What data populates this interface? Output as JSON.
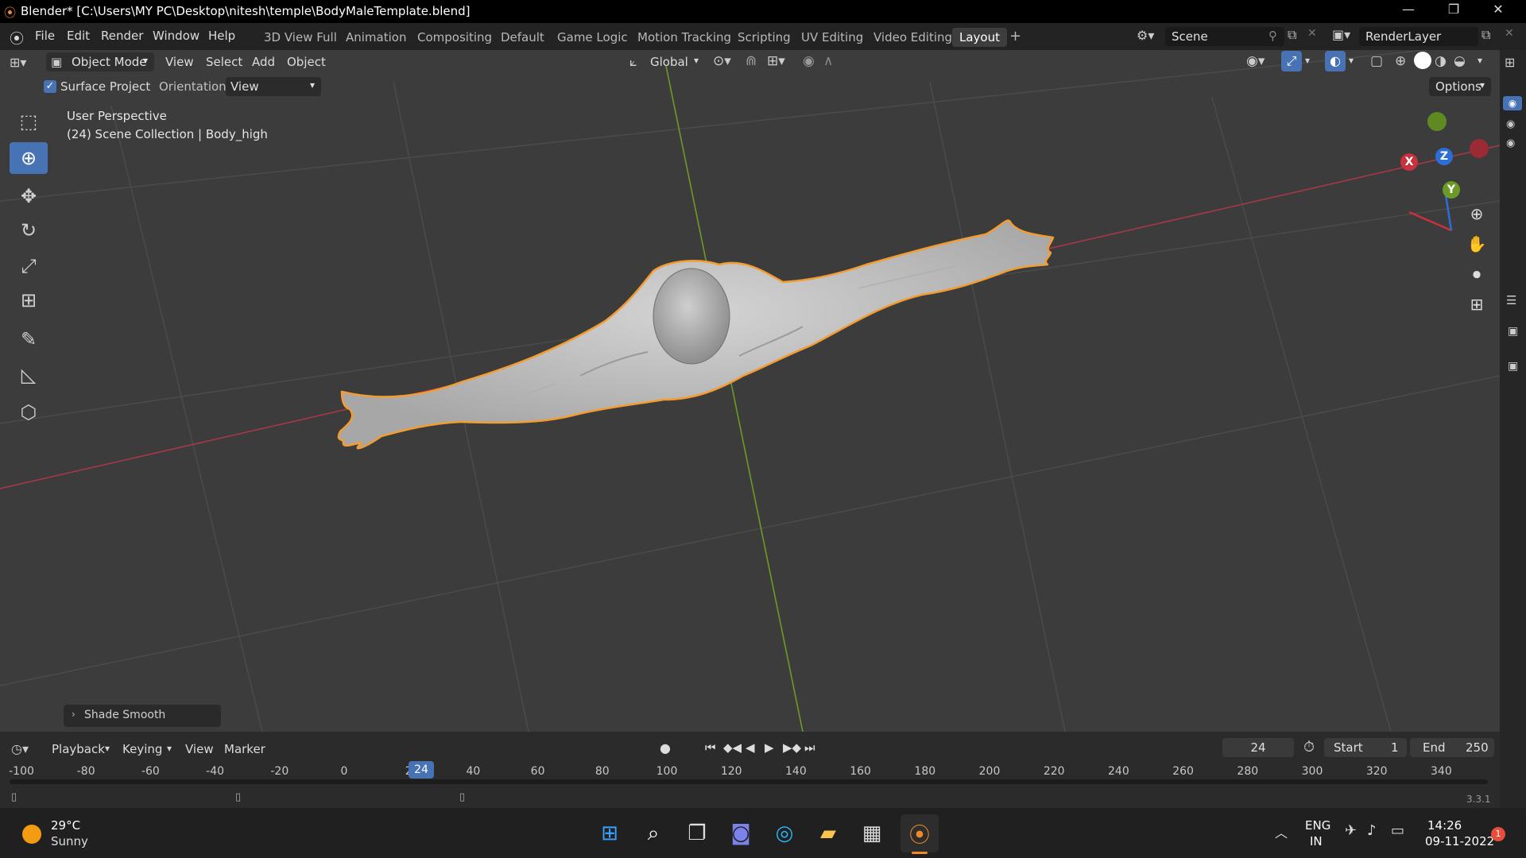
{
  "titlebar": {
    "title": "Blender* [C:\\Users\\MY PC\\Desktop\\nitesh\\temple\\BodyMaleTemplate.blend]",
    "minimize": "—",
    "restore": "❐",
    "close": "✕"
  },
  "menus": [
    "File",
    "Edit",
    "Render",
    "Window",
    "Help"
  ],
  "workspaces": [
    "3D View Full",
    "Animation",
    "Compositing",
    "Default",
    "Game Logic",
    "Motion Tracking",
    "Scripting",
    "UV Editing",
    "Video Editing",
    "Layout"
  ],
  "active_workspace": "Layout",
  "add_workspace": "+",
  "scene": {
    "label": "Scene"
  },
  "render_layer": {
    "label": "RenderLayer"
  },
  "header": {
    "mode": "Object Mode",
    "menus": [
      "View",
      "Select",
      "Add",
      "Object"
    ],
    "transform_orientation": "Global"
  },
  "tool_settings": {
    "surface_project_label": "Surface Project",
    "surface_project_checked": true,
    "orientation_label": "Orientation:",
    "orientation_value": "View",
    "options_label": "Options"
  },
  "viewport": {
    "perspective": "User Perspective",
    "collection_info": "(24) Scene Collection | Body_high",
    "last_operation": "Shade Smooth",
    "gizmo": {
      "x": "X",
      "y": "Y",
      "z": "Z"
    }
  },
  "colors": {
    "selection_outline": "#f39c32",
    "x_axis": "#c8313e",
    "y_axis": "#6a9a1f",
    "z_axis": "#2b6fd6",
    "active_tool": "#4772b3"
  },
  "timeline": {
    "menus": [
      "Playback",
      "Keying",
      "View",
      "Marker"
    ],
    "current_frame": "24",
    "start_label": "Start",
    "start_value": "1",
    "end_label": "End",
    "end_value": "250",
    "ruler_labels": [
      "-100",
      "-80",
      "-60",
      "-40",
      "-20",
      "0",
      "2",
      "40",
      "60",
      "80",
      "100",
      "120",
      "140",
      "160",
      "180",
      "200",
      "220",
      "240",
      "260",
      "280",
      "300",
      "320",
      "340"
    ],
    "playhead_label": "24",
    "version": "3.3.1"
  },
  "taskbar": {
    "weather_temp": "29°C",
    "weather_desc": "Sunny",
    "lang_top": "ENG",
    "lang_bottom": "IN",
    "time": "14:26",
    "date": "09-11-2022",
    "notification_count": "1"
  }
}
